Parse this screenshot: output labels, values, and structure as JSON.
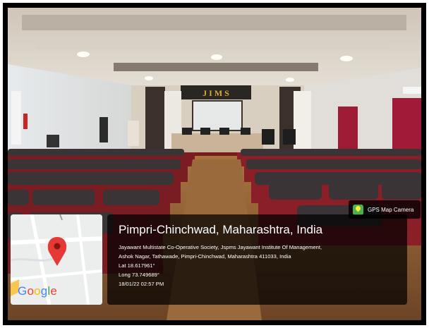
{
  "badge": {
    "label": "GPS Map Camera",
    "icon": "gps-map-camera-logo-icon"
  },
  "map": {
    "logo_letters": [
      "G",
      "o",
      "o",
      "g",
      "l",
      "e"
    ],
    "logo_colors": [
      "#4285F4",
      "#EA4335",
      "#FBBC05",
      "#4285F4",
      "#34A853",
      "#EA4335"
    ],
    "pin_color": "#e53935",
    "pin_icon": "map-pin-icon"
  },
  "location": {
    "title": "Pimpri-Chinchwad, Maharashtra, India",
    "address_line1": "Jayawant Multistate Co-Operative Society, Jspms Jayawant Institute Of Management,",
    "address_line2": "Ashok Nagar, Tathawade, Pimpri-Chinchwad, Maharashtra 411033, India",
    "lat": "Lat 18.617961°",
    "long": "Long 73.749689°",
    "datetime": "18/01/22 02:57 PM"
  },
  "stage_banner": "J I M S"
}
